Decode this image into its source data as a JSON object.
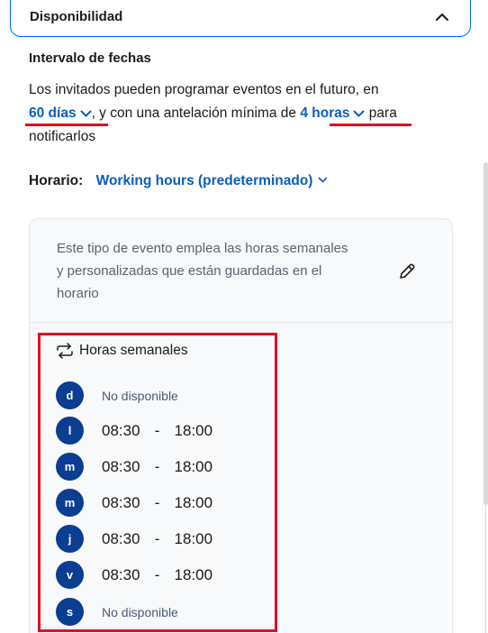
{
  "accordion": {
    "title": "Disponibilidad"
  },
  "date_range": {
    "title": "Intervalo de fechas",
    "text_1": "Los invitados pueden programar eventos en el futuro, en",
    "days_select": "60 días",
    "text_2": ", y con una antelación mínima de",
    "hours_select": "4 horas",
    "text_3": "para notificarlos"
  },
  "schedule": {
    "label": "Horario:",
    "value": "Working hours (predeterminado)"
  },
  "card": {
    "description": "Este tipo de evento emplea las horas semanales y personalizadas que están guardadas en el horario"
  },
  "weekly": {
    "title": "Horas semanales",
    "days": [
      {
        "letter": "d",
        "status": "No disponible"
      },
      {
        "letter": "l",
        "start": "08:30",
        "sep": "-",
        "end": "18:00"
      },
      {
        "letter": "m",
        "start": "08:30",
        "sep": "-",
        "end": "18:00"
      },
      {
        "letter": "m",
        "start": "08:30",
        "sep": "-",
        "end": "18:00"
      },
      {
        "letter": "j",
        "start": "08:30",
        "sep": "-",
        "end": "18:00"
      },
      {
        "letter": "v",
        "start": "08:30",
        "sep": "-",
        "end": "18:00"
      },
      {
        "letter": "s",
        "status": "No disponible"
      }
    ]
  },
  "colors": {
    "accent": "#0069ff",
    "link": "#0b5cbe",
    "badge": "#0b3d91",
    "highlight": "#e01020"
  },
  "icons": {
    "collapse": "chevron-up-icon",
    "dropdown": "chevron-down-icon",
    "edit": "pencil-icon",
    "repeat": "repeat-icon"
  }
}
